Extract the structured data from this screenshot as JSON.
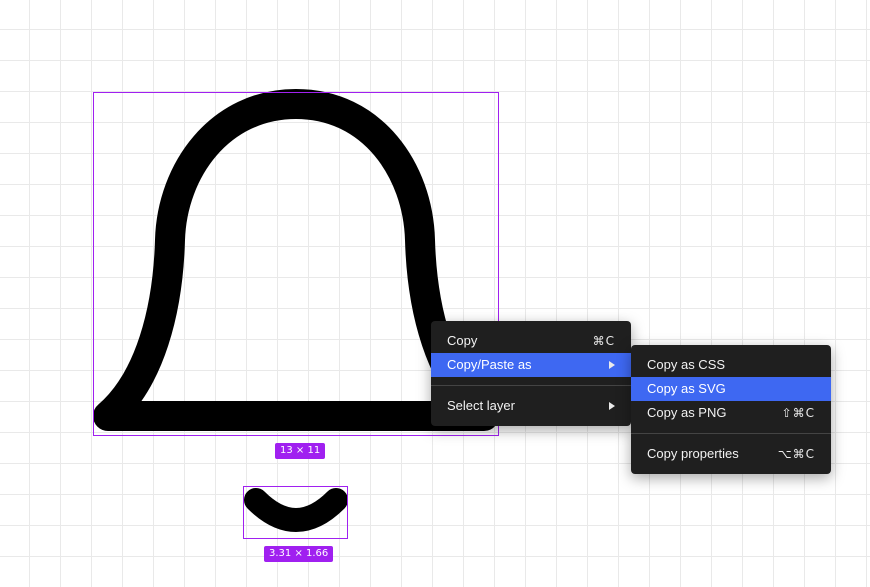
{
  "canvas": {
    "bell_dimensions": "13 × 11",
    "clapper_dimensions": "3.31 × 1.66"
  },
  "colors": {
    "selection": "#a020f0",
    "menu_bg": "#1f1f1f",
    "menu_highlight": "#3e68f2",
    "shape_stroke": "#000000"
  },
  "context_menu": {
    "copy": {
      "label": "Copy",
      "shortcut": "⌘C"
    },
    "copy_paste_as": {
      "label": "Copy/Paste as"
    },
    "select_layer": {
      "label": "Select layer"
    }
  },
  "submenu": {
    "copy_css": {
      "label": "Copy as CSS"
    },
    "copy_svg": {
      "label": "Copy as SVG"
    },
    "copy_png": {
      "label": "Copy as PNG",
      "shortcut": "⇧⌘C"
    },
    "copy_properties": {
      "label": "Copy properties",
      "shortcut": "⌥⌘C"
    }
  }
}
